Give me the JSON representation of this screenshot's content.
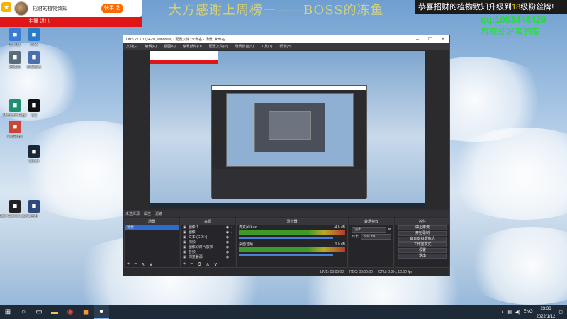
{
  "overlay": {
    "notify_name": "招财的植物致知",
    "notify_platform": "快手 艺",
    "notify_strip": "主播 进出",
    "marquee": "大方感谢上周榜一——BOSS的冻鱼",
    "promo_prefix": "恭喜",
    "promo_name": "招财的植物致知",
    "promo_mid": "升级到",
    "promo_level": "18",
    "promo_suffix": "级粉丝牌!",
    "qq": "qq:1003446429",
    "home": "游戏爱好者的家"
  },
  "desktop_icons": [
    {
      "name": "computer-icon",
      "label": "此电脑",
      "color": "#3b7bd6"
    },
    {
      "name": "network-icon",
      "label": "网络",
      "color": "#2a7cc8"
    },
    {
      "name": "recycle-icon",
      "label": "回收站",
      "color": "#5a6b7a"
    },
    {
      "name": "control-icon",
      "label": "控制面板",
      "color": "#4a6fb0"
    },
    {
      "name": "edge-icon",
      "label": "Microsoft Edge",
      "color": "#1e8f6f"
    },
    {
      "name": "qq-icon",
      "label": "QQ",
      "color": "#111"
    },
    {
      "name": "game-icon",
      "label": "WeGame",
      "color": "#c43"
    },
    {
      "name": "steam-icon",
      "label": "Steam",
      "color": "#1b2838"
    },
    {
      "name": "epic-icon",
      "label": "Epic Games Launcher",
      "color": "#222"
    },
    {
      "name": "app-icon",
      "label": "应用",
      "color": "#2d4a7a"
    }
  ],
  "obs": {
    "title": "OBS 27.1.1 (64-bit, windows) - 配置文件: 未命名 - 场景: 未命名",
    "menus": [
      "文件(F)",
      "编辑(E)",
      "视图(V)",
      "停靠部件(D)",
      "配置文件(P)",
      "场景集合(S)",
      "工具(T)",
      "帮助(H)"
    ],
    "source_bar": [
      "未选择源",
      "属性",
      "滤镜"
    ],
    "docks": {
      "scenes": {
        "title": "场景",
        "items": [
          "场景"
        ]
      },
      "sources": {
        "title": "来源",
        "items": [
          "图像 1",
          "图像",
          "文本 (GDI+)",
          "视频",
          "图像幻灯片放映",
          "音频",
          "浏览器源"
        ]
      },
      "mixer": {
        "title": "混音器",
        "channels": [
          "麦克风/Aux",
          "桌面音频"
        ],
        "levels": [
          "-4.6 dB",
          "0.0 dB"
        ]
      },
      "transitions": {
        "title": "转场特效",
        "type": "淡出",
        "duration_label": "时长",
        "duration": "300 ms"
      },
      "controls": {
        "title": "控件",
        "buttons": [
          "停止推流",
          "开始录制",
          "启动虚拟摄像机",
          "工作室模式",
          "设置",
          "退出"
        ]
      }
    },
    "status": [
      "LIVE: 00:00:00",
      "REC: 00:00:00",
      "CPU: 2.9%, 10.00 fps"
    ]
  },
  "taskbar": {
    "tray": [
      "ENG"
    ],
    "time": "23:36",
    "date": "2022/1/12"
  }
}
